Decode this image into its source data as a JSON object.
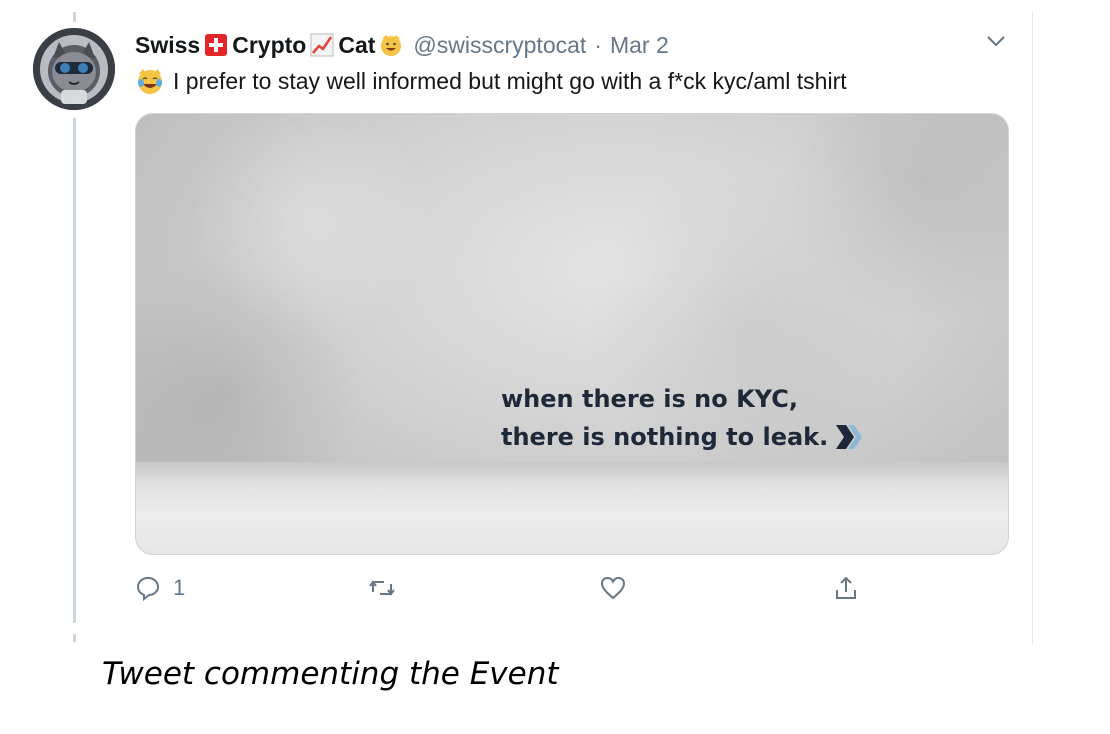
{
  "tweet": {
    "name_part1": "Swiss",
    "name_part2": "Crypto",
    "name_part3": "Cat",
    "handle": "@swisscryptocat",
    "separator": "·",
    "date": "Mar 2",
    "text": "I prefer to stay well informed but might go with a f*ck kyc/aml tshirt",
    "media": {
      "line1": "when there is no KYC,",
      "line2": "there is nothing to leak."
    },
    "actions": {
      "reply_count": "1"
    },
    "icons": {
      "swiss_flag": "swiss-flag-emoji",
      "chart": "chart-increasing-emoji",
      "cat": "grinning-cat-emoji",
      "laughing": "tears-of-joy-emoji",
      "menu": "chevron-down-icon",
      "reply": "reply-icon",
      "retweet": "retweet-icon",
      "like": "heart-icon",
      "share": "share-icon"
    },
    "colors": {
      "text": "#14171a",
      "muted": "#657786",
      "border": "#ccd6dd"
    }
  },
  "caption": "Tweet commenting the Event"
}
